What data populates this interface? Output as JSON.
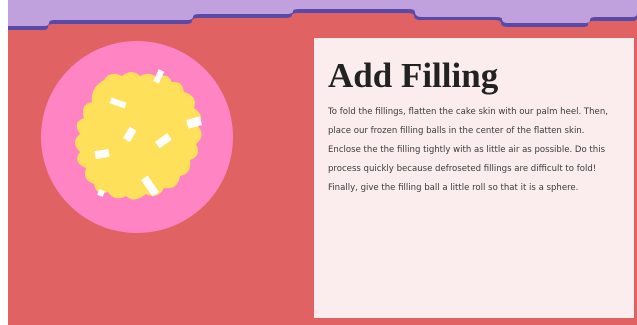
{
  "step": {
    "title": "Add Filling",
    "description": "To fold the fillings, flatten the cake skin with our palm heel. Then, place our frozen filling balls in the center of the flatten skin. Enclose the the filling tightly with as little air as possible. Do this process quickly because defroseted fillings are difficult to fold! Finally, give the filling ball a little roll so that it is a sphere."
  },
  "illustration": {
    "subject": "cake-skin-with-filling",
    "colors": {
      "plate": "#ff84c4",
      "filling": "#ffe05a",
      "flakes": "#ffffff"
    }
  },
  "colors": {
    "background": "#e06262",
    "card": "#fbeded",
    "top_wave": "#c1a0de",
    "top_wave_shadow": "#5a4aa8"
  }
}
